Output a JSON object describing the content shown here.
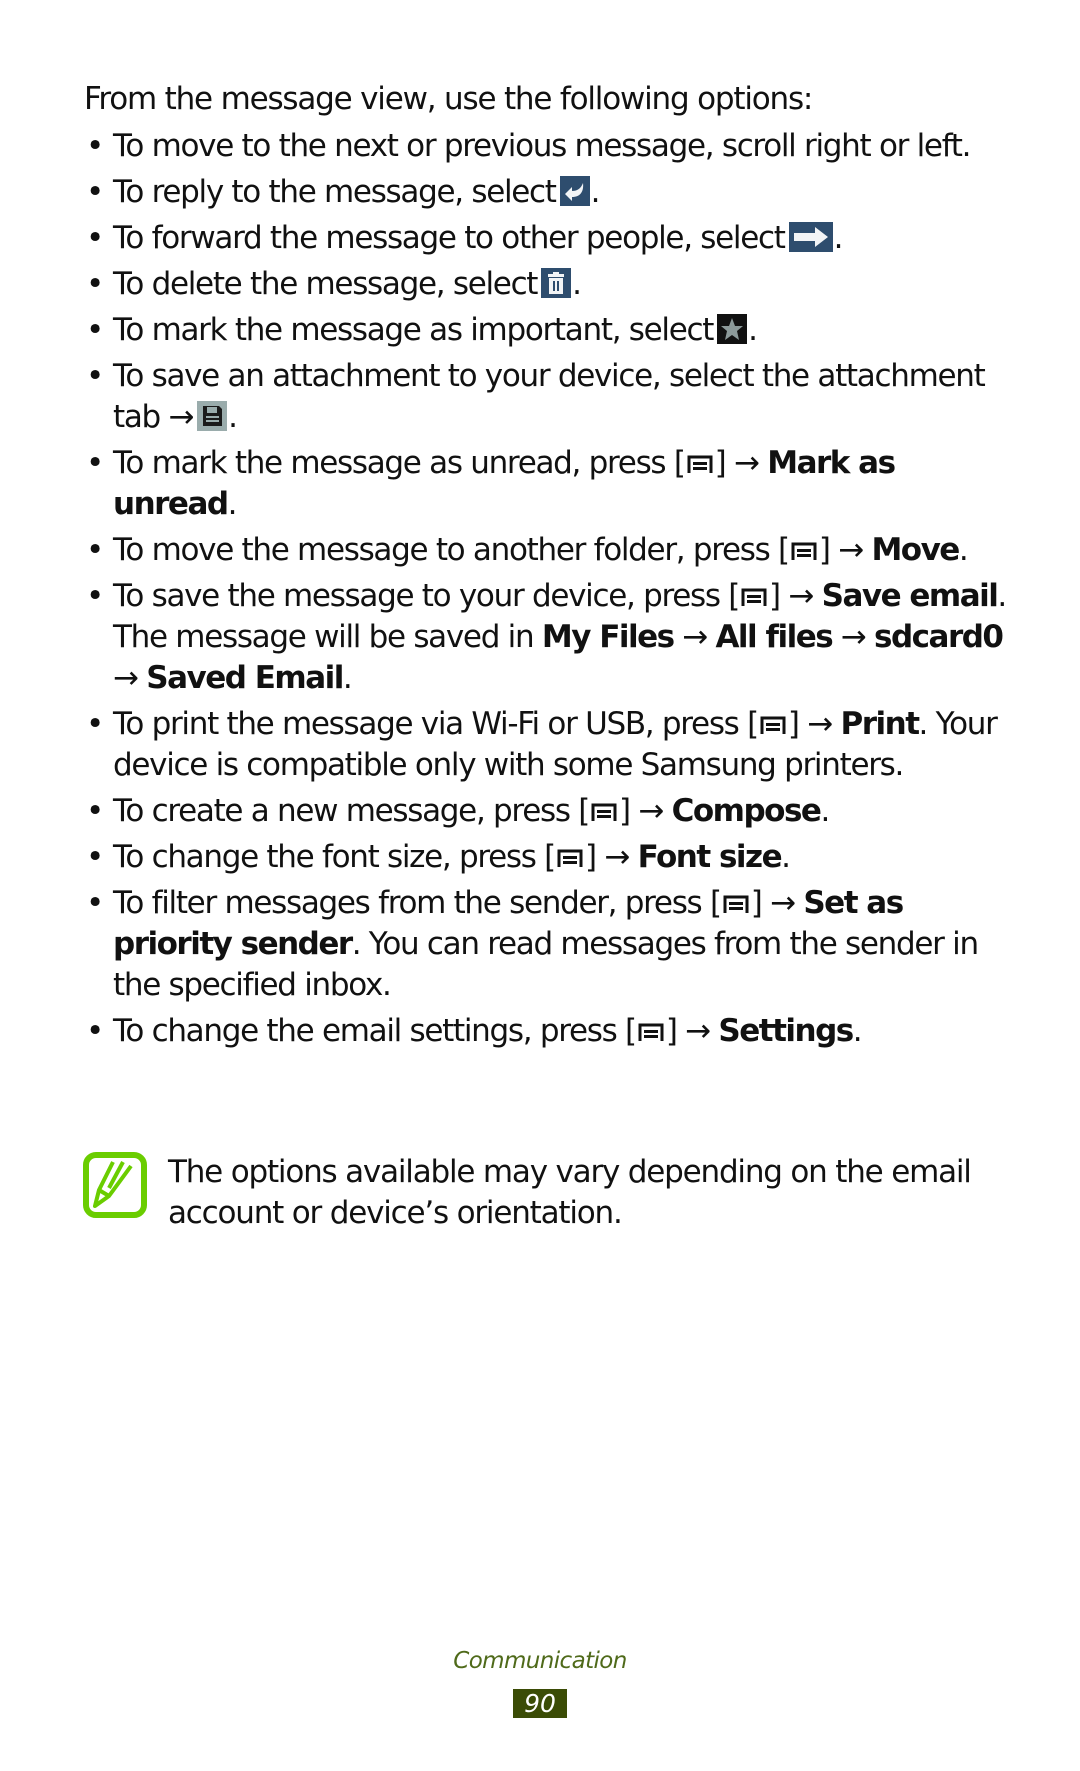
{
  "intro": "From the message view, use the following options:",
  "bullet": "•",
  "items": [
    {
      "pre": "To move to the next or previous message, scroll right or left."
    },
    {
      "pre": "To reply to the message, select",
      "icon": "reply-icon",
      "post": "."
    },
    {
      "pre": "To forward the message to other people, select",
      "icon": "forward-icon",
      "post": "."
    },
    {
      "pre": "To delete the message, select",
      "icon": "delete-icon",
      "post": "."
    },
    {
      "pre": "To mark the message as important, select",
      "icon": "star-icon",
      "post": "."
    },
    {
      "pre": "To save an attachment to your device, select the attachment tab →",
      "icon": "save-icon",
      "post": "."
    },
    {
      "pre": "To mark the message as unread, press [",
      "key": "menu-key-icon",
      "mid": "] →",
      "bold1": "Mark as unread",
      "post": "."
    },
    {
      "pre": "To move the message to another folder, press [",
      "key": "menu-key-icon",
      "mid": "] →",
      "bold1": "Move",
      "post": "."
    },
    {
      "pre": "To save the message to your device, press [",
      "key": "menu-key-icon",
      "mid": "] →",
      "bold1": "Save email",
      "text2": ". The message will be saved in",
      "bold2": "My Files",
      "arrow2": "→",
      "bold3": "All files",
      "arrow3": "→",
      "bold4": "sdcard0",
      "arrow4": "→",
      "bold5": "Saved Email",
      "post": "."
    },
    {
      "pre": "To print the message via Wi-Fi or USB, press [",
      "key": "menu-key-icon",
      "mid": "] →",
      "bold1": "Print",
      "text2": ". Your device is compatible only with some Samsung printers."
    },
    {
      "pre": "To create a new message, press [",
      "key": "menu-key-icon",
      "mid": "] →",
      "bold1": "Compose",
      "post": "."
    },
    {
      "pre": "To change the font size, press [",
      "key": "menu-key-icon",
      "mid": "] →",
      "bold1": "Font size",
      "post": "."
    },
    {
      "pre": "To filter messages from the sender, press [",
      "key": "menu-key-icon",
      "mid": "] →",
      "bold1": "Set as priority sender",
      "text2": ". You can read messages from the sender in the specified inbox."
    },
    {
      "pre": "To change the email settings, press [",
      "key": "menu-key-icon",
      "mid": "] →",
      "bold1": "Settings",
      "post": "."
    }
  ],
  "note": {
    "icon": "note-pencil-icon",
    "text": "The options available may vary depending on the email account or device’s orientation."
  },
  "footer": {
    "section": "Communication",
    "page_number": "90"
  },
  "colors": {
    "icon_blue": "#2e4d6e",
    "note_green": "#6acd00",
    "footer_green": "#4f6a1a",
    "page_box": "#3b4c06"
  }
}
